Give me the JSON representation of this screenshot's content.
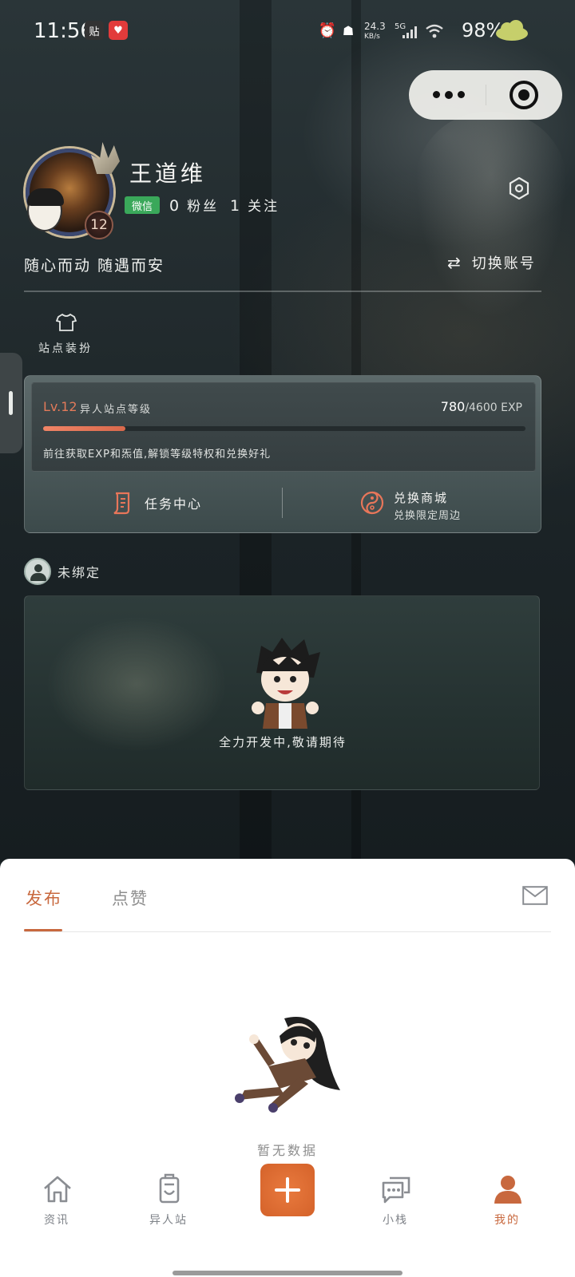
{
  "status_bar": {
    "time": "11:56",
    "app_badge_1": "贴",
    "net_speed": "24.3",
    "net_unit": "KB/s",
    "network": "5G",
    "battery": "98%"
  },
  "profile": {
    "username": "王道维",
    "level_badge": "12",
    "account_tag": "微信",
    "fans_count": "0",
    "fans_label": "粉丝",
    "follow_count": "1",
    "follow_label": "关注",
    "bio": "随心而动 随遇而安",
    "switch_account_label": "切换账号",
    "decor_label": "站点装扮"
  },
  "level_card": {
    "level": "Lv.12",
    "level_title": "异人站点等级",
    "exp_current": "780",
    "exp_max": "/4600 EXP",
    "progress": 0.17,
    "hint": "前往获取EXP和炁值,解锁等级特权和兑换好礼",
    "task_center_label": "任务中心",
    "redeem_title": "兑换商城",
    "redeem_subtitle": "兑换限定周边"
  },
  "binding": {
    "status": "未绑定",
    "dev_message": "全力开发中,敬请期待"
  },
  "sheet": {
    "tabs": [
      {
        "label": "发布",
        "active": true
      },
      {
        "label": "点赞",
        "active": false
      }
    ],
    "empty_text": "暂无数据"
  },
  "bottom_nav": {
    "items": [
      {
        "label": "资讯",
        "icon": "home-icon",
        "active": false
      },
      {
        "label": "异人站",
        "icon": "station-icon",
        "active": false
      },
      {
        "label": "",
        "icon": "plus-icon",
        "active": false
      },
      {
        "label": "小栈",
        "icon": "chat-icon",
        "active": false
      },
      {
        "label": "我的",
        "icon": "person-icon",
        "active": true
      }
    ]
  },
  "colors": {
    "accent": "#c8683e",
    "progress": "#f08466",
    "wechat": "#3aa85a"
  }
}
